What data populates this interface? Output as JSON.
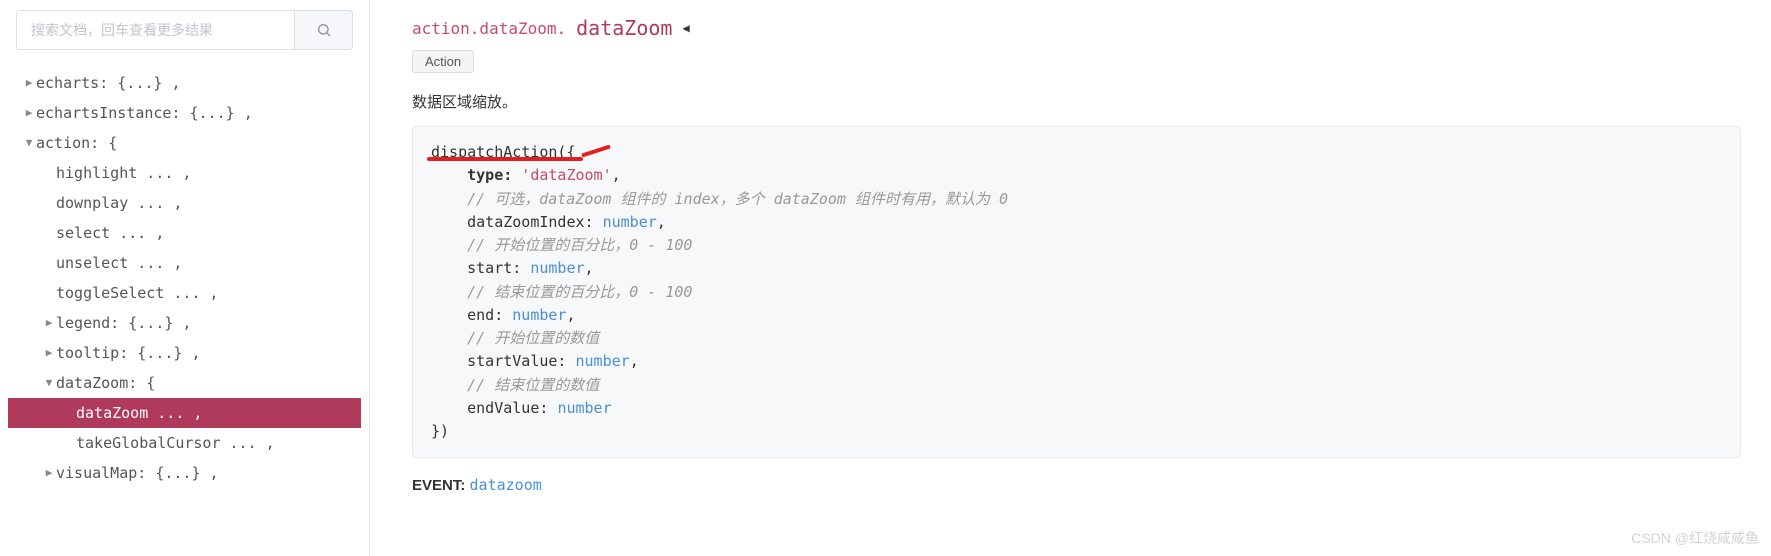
{
  "search": {
    "placeholder": "搜索文档，回车查看更多结果"
  },
  "tree": {
    "r0": "echarts: {...} ,",
    "r1": "echartsInstance: {...} ,",
    "r2": "action: {",
    "r3": "highlight ... ,",
    "r4": "downplay ... ,",
    "r5": "select ... ,",
    "r6": "unselect ... ,",
    "r7": "toggleSelect ... ,",
    "r8": "legend: {...} ,",
    "r9": "tooltip: {...} ,",
    "r10": "dataZoom: {",
    "r11": "dataZoom ... ,",
    "r12": "takeGlobalCursor ... ,",
    "r13": "visualMap: {...} ,"
  },
  "breadcrumb": {
    "path": "action.dataZoom.",
    "current": "dataZoom"
  },
  "badge": "Action",
  "desc": "数据区域缩放。",
  "code": {
    "l1a": "dispatchAction({",
    "l2a": "    ",
    "l2b": "type:",
    "l2c": " 'dataZoom'",
    "l2d": ",",
    "l3": "    // 可选，dataZoom 组件的 index，多个 dataZoom 组件时有用，默认为 0",
    "l4a": "    dataZoomIndex: ",
    "l4b": "number",
    "l4c": ",",
    "l5": "    // 开始位置的百分比，0 - 100",
    "l6a": "    start: ",
    "l6b": "number",
    "l6c": ",",
    "l7": "    // 结束位置的百分比，0 - 100",
    "l8a": "    end: ",
    "l8b": "number",
    "l8c": ",",
    "l9": "    // 开始位置的数值",
    "l10a": "    startValue: ",
    "l10b": "number",
    "l10c": ",",
    "l11": "    // 结束位置的数值",
    "l12a": "    endValue: ",
    "l12b": "number",
    "l13": "})"
  },
  "event": {
    "label": "EVENT:",
    "name": "datazoom"
  },
  "watermark": "CSDN @红烧咸咸鱼"
}
